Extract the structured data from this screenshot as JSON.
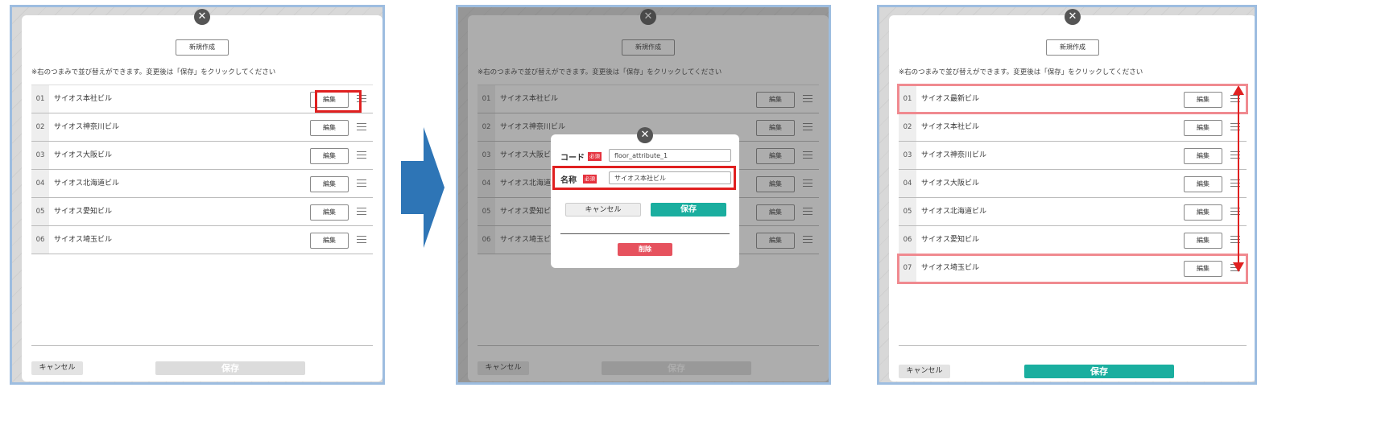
{
  "panel1": {
    "close": "✕",
    "new_button": "新規作成",
    "hint": "※右のつまみで並び替えができます。変更後は「保存」をクリックしてください",
    "rows": [
      {
        "num": "01",
        "name": "サイオス本社ビル",
        "edit": "編集"
      },
      {
        "num": "02",
        "name": "サイオス神奈川ビル",
        "edit": "編集"
      },
      {
        "num": "03",
        "name": "サイオス大阪ビル",
        "edit": "編集"
      },
      {
        "num": "04",
        "name": "サイオス北海道ビル",
        "edit": "編集"
      },
      {
        "num": "05",
        "name": "サイオス愛知ビル",
        "edit": "編集"
      },
      {
        "num": "06",
        "name": "サイオス埼玉ビル",
        "edit": "編集"
      }
    ],
    "cancel": "キャンセル",
    "save": "保存"
  },
  "panel2": {
    "close": "✕",
    "new_button": "新規作成",
    "hint": "※右のつまみで並び替えができます。変更後は「保存」をクリックしてください",
    "rows": [
      {
        "num": "01",
        "name": "サイオス本社ビル",
        "edit": "編集"
      },
      {
        "num": "02",
        "name": "サイオス神奈川ビル",
        "edit": "編集"
      },
      {
        "num": "03",
        "name": "サイオス大阪ビル",
        "edit": "編集"
      },
      {
        "num": "04",
        "name": "サイオス北海道ビル",
        "edit": "編集"
      },
      {
        "num": "05",
        "name": "サイオス愛知ビル",
        "edit": "編集"
      },
      {
        "num": "06",
        "name": "サイオス埼玉ビル",
        "edit": "編集"
      }
    ],
    "cancel": "キャンセル",
    "save": "保存",
    "dialog": {
      "close": "✕",
      "code_label": "コード",
      "name_label": "名称",
      "required_badge": "必須",
      "code_value": "floor_attribute_1",
      "name_value": "サイオス本社ビル",
      "cancel": "キャンセル",
      "save": "保存",
      "delete": "削除"
    }
  },
  "panel3": {
    "close": "✕",
    "new_button": "新規作成",
    "hint": "※右のつまみで並び替えができます。変更後は「保存」をクリックしてください",
    "rows": [
      {
        "num": "01",
        "name": "サイオス最新ビル",
        "edit": "編集"
      },
      {
        "num": "02",
        "name": "サイオス本社ビル",
        "edit": "編集"
      },
      {
        "num": "03",
        "name": "サイオス神奈川ビル",
        "edit": "編集"
      },
      {
        "num": "04",
        "name": "サイオス大阪ビル",
        "edit": "編集"
      },
      {
        "num": "05",
        "name": "サイオス北海道ビル",
        "edit": "編集"
      },
      {
        "num": "06",
        "name": "サイオス愛知ビル",
        "edit": "編集"
      },
      {
        "num": "07",
        "name": "サイオス埼玉ビル",
        "edit": "編集"
      }
    ],
    "cancel": "キャンセル",
    "save": "保存"
  },
  "colors": {
    "accent": "#1aae9f",
    "highlight": "#e02020",
    "panel_border": "#9dbde0",
    "flow_arrow": "#2e75b6"
  }
}
